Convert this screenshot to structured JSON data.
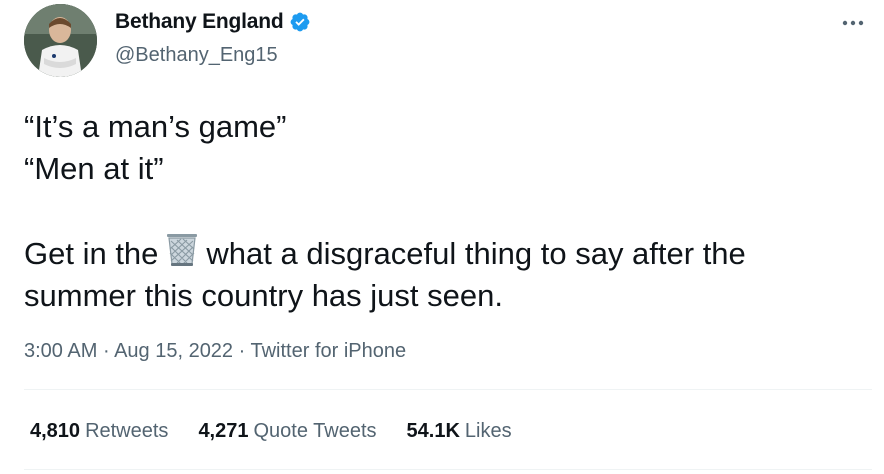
{
  "author": {
    "display_name": "Bethany England",
    "handle": "@Bethany_Eng15",
    "verified": true,
    "verified_color": "#1d9bf0"
  },
  "tweet": {
    "line1": "“It’s a man’s game”",
    "line2": "“Men at it”",
    "line3_before": "Get in the",
    "emoji": "wastebasket-icon",
    "line3_after": "what a disgraceful thing to say after the",
    "line4": "summer this country has just seen."
  },
  "meta": {
    "time": "3:00 AM",
    "separator1": " · ",
    "date": "Aug 15, 2022",
    "separator2": " · ",
    "source": "Twitter for iPhone"
  },
  "stats": {
    "retweets_count": "4,810",
    "retweets_label": "Retweets",
    "quotes_count": "4,271",
    "quotes_label": "Quote Tweets",
    "likes_count": "54.1K",
    "likes_label": "Likes"
  },
  "colors": {
    "text": "#0f1419",
    "secondary": "#536471",
    "divider": "#eff3f4"
  }
}
